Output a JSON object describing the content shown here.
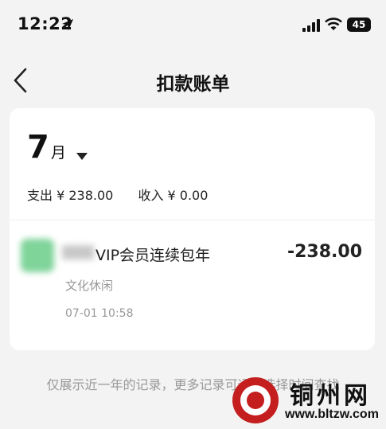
{
  "status_bar": {
    "time": "12:22",
    "battery": "45"
  },
  "header": {
    "title": "扣款账单"
  },
  "month": {
    "number": "7",
    "unit": "月"
  },
  "summary": {
    "expense": "支出 ¥ 238.00",
    "income": "收入 ¥ 0.00"
  },
  "transactions": [
    {
      "title": "VIP会员连续包年",
      "amount": "-238.00",
      "category": "文化休闲",
      "time": "07-01 10:58"
    }
  ],
  "footer": {
    "note": "仅展示近一年的记录，更多记录可通过选择时间查找"
  },
  "watermark": {
    "name": "铜州网",
    "url": "www.bltzw.com"
  },
  "colors": {
    "accent": "#c41e1e",
    "background": "#f3f3f3",
    "muted_text": "#999999"
  }
}
